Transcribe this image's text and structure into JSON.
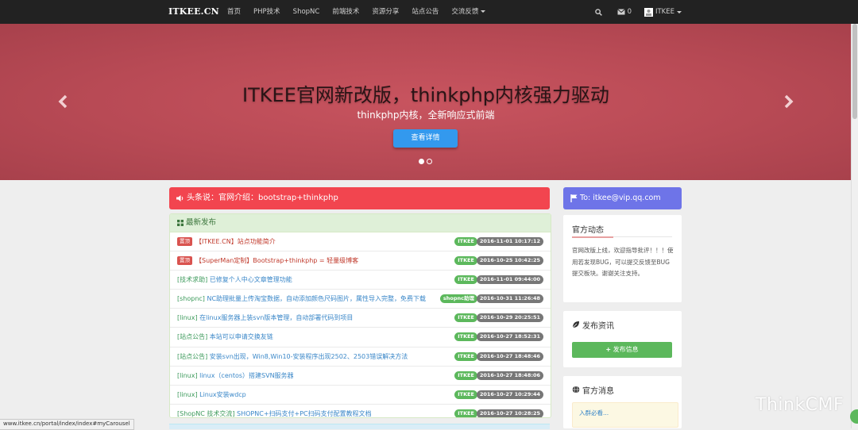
{
  "navbar": {
    "brand": "ITKEE.CN",
    "links": [
      "首页",
      "PHP技术",
      "ShopNC",
      "前端技术",
      "资源分享",
      "站点公告",
      "交流反馈"
    ],
    "mail_count": "0",
    "user_label": "ITKEE"
  },
  "carousel": {
    "title": "ITKEE官网新改版，thinkphp内核强力驱动",
    "subtitle": "thinkphp内核，全新响应式前端",
    "button_label": "查看详情"
  },
  "headline": {
    "text": "头条说：官网介绍：bootstrap+thinkphp",
    "color": "#f2454f"
  },
  "latest": {
    "title": "最新发布",
    "items": [
      {
        "tag": "置顶",
        "category": "",
        "title": "【ITKEE.CN】站点功能简介",
        "source": "ITKEE",
        "time": "2016-11-01 10:17:12"
      },
      {
        "tag": "置顶",
        "category": "",
        "title": "【SuperMan定制】Bootstrap+thinkphp = 轻量级博客",
        "source": "ITKEE",
        "time": "2016-10-25 10:42:25"
      },
      {
        "tag": "",
        "category": "[技术求助]",
        "title": "已修复个人中心文章管理功能",
        "source": "ITKEE",
        "time": "2016-11-01 09:44:00"
      },
      {
        "tag": "",
        "category": "[shopnc]",
        "title": "NC助理批量上传淘宝数据，自动添加颜色尺码图片，属性导入完整，免费下载",
        "source": "shopnc助理",
        "time": "2016-10-31 11:26:48"
      },
      {
        "tag": "",
        "category": "[linux]",
        "title": "在linux服务器上装svn版本管理，自动部署代码到项目",
        "source": "ITKEE",
        "time": "2016-10-29 20:25:51"
      },
      {
        "tag": "",
        "category": "[站点公告]",
        "title": "本站可以申请交换友链",
        "source": "ITKEE",
        "time": "2016-10-27 18:52:31"
      },
      {
        "tag": "",
        "category": "[站点公告]",
        "title": "安装svn出现，Win8,Win10-安装程序出现2502、2503错误解决方法",
        "source": "ITKEE",
        "time": "2016-10-27 18:48:46"
      },
      {
        "tag": "",
        "category": "[linux]",
        "title": "linux（centos）搭建SVN服务器",
        "source": "ITKEE",
        "time": "2016-10-27 18:48:06"
      },
      {
        "tag": "",
        "category": "[linux]",
        "title": "Linux安装wdcp",
        "source": "ITKEE",
        "time": "2016-10-27 10:29:44"
      },
      {
        "tag": "",
        "category": "[ShopNC 技术交流]",
        "title": "SHOPNC+扫码支付+PC扫码支付配置教程文档",
        "source": "ITKEE",
        "time": "2016-10-27 10:28:25"
      }
    ]
  },
  "sidebar": {
    "email": "To: itkee@vip.qq.com",
    "notice_title": "官方动态",
    "notice_text": "官网改版上线，欢迎指导批评！！！使用若发现BUG，可以提交反馈至BUG提交板块。谢谢关注支持。",
    "publish_title": "发布资讯",
    "publish_button": "发布信息",
    "messages_title": "官方消息",
    "message_item": "入群必看..."
  },
  "status_bar": "www.itkee.cn/portal/index/index#myCarousel",
  "watermark": "ThinkCMF"
}
